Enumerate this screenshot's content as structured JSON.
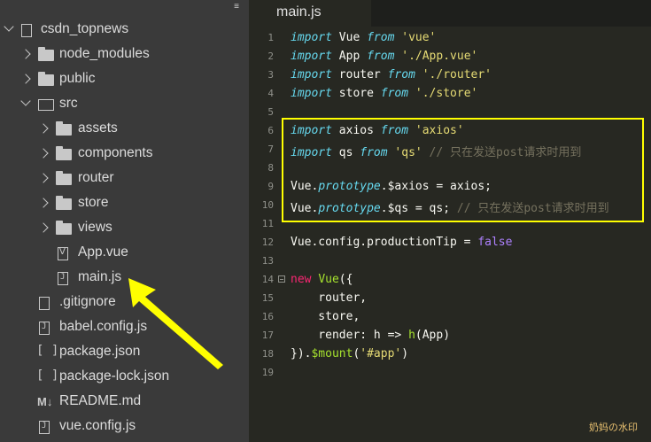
{
  "sidebar": {
    "root": "csdn_topnews",
    "items": [
      {
        "label": "node_modules",
        "kind": "folder"
      },
      {
        "label": "public",
        "kind": "folder"
      },
      {
        "label": "src",
        "kind": "folder-open"
      },
      {
        "label": "assets",
        "kind": "folder"
      },
      {
        "label": "components",
        "kind": "folder"
      },
      {
        "label": "router",
        "kind": "folder"
      },
      {
        "label": "store",
        "kind": "folder"
      },
      {
        "label": "views",
        "kind": "folder"
      },
      {
        "label": "App.vue",
        "kind": "file-vue"
      },
      {
        "label": "main.js",
        "kind": "file-js"
      },
      {
        "label": ".gitignore",
        "kind": "file"
      },
      {
        "label": "babel.config.js",
        "kind": "file-js"
      },
      {
        "label": "package.json",
        "kind": "json"
      },
      {
        "label": "package-lock.json",
        "kind": "json"
      },
      {
        "label": "README.md",
        "kind": "md"
      },
      {
        "label": "vue.config.js",
        "kind": "file-js"
      }
    ],
    "menu_icon": "hamburger-icon"
  },
  "editor": {
    "tab": "main.js",
    "line_numbers": [
      "1",
      "2",
      "3",
      "4",
      "5",
      "6",
      "7",
      "8",
      "9",
      "10",
      "11",
      "12",
      "13",
      "14",
      "15",
      "16",
      "17",
      "18",
      "19"
    ]
  },
  "code": {
    "l1": {
      "kw": "import",
      "a": " Vue ",
      "from": "from",
      "s": "'vue'"
    },
    "l2": {
      "kw": "import",
      "a": " App ",
      "from": "from",
      "s": "'./App.vue'"
    },
    "l3": {
      "kw": "import",
      "a": " router ",
      "from": "from",
      "s": "'./router'"
    },
    "l4": {
      "kw": "import",
      "a": " store ",
      "from": "from",
      "s": "'./store'"
    },
    "l6": {
      "kw": "import",
      "a": " axios ",
      "from": "from",
      "s": "'axios'"
    },
    "l7": {
      "kw": "import",
      "a": " qs ",
      "from": "from",
      "s": "'qs'",
      "cm": " // 只在发送post请求时用到"
    },
    "l9": {
      "a": "Vue.",
      "p": "prototype",
      "b": ".$axios = axios;"
    },
    "l10": {
      "a": "Vue.",
      "p": "prototype",
      "b": ".$qs = qs;",
      "cm": " // 只在发送post请求时用到"
    },
    "l12": {
      "a": "Vue.config.productionTip = ",
      "v": "false"
    },
    "l14": {
      "kw": "new",
      "a": " ",
      "fn": "Vue",
      "b": "({"
    },
    "l15": "    router,",
    "l16": "    store,",
    "l17": {
      "a": "    render: h => ",
      "fn": "h",
      "b": "(App)"
    },
    "l18": {
      "a": "}).",
      "fn": "$mount",
      "b": "(",
      "s": "'#app'",
      "c": ")"
    }
  },
  "watermark": "奶妈の水印",
  "colors": {
    "highlight": "#ffff00",
    "arrow": "#ffff00"
  }
}
